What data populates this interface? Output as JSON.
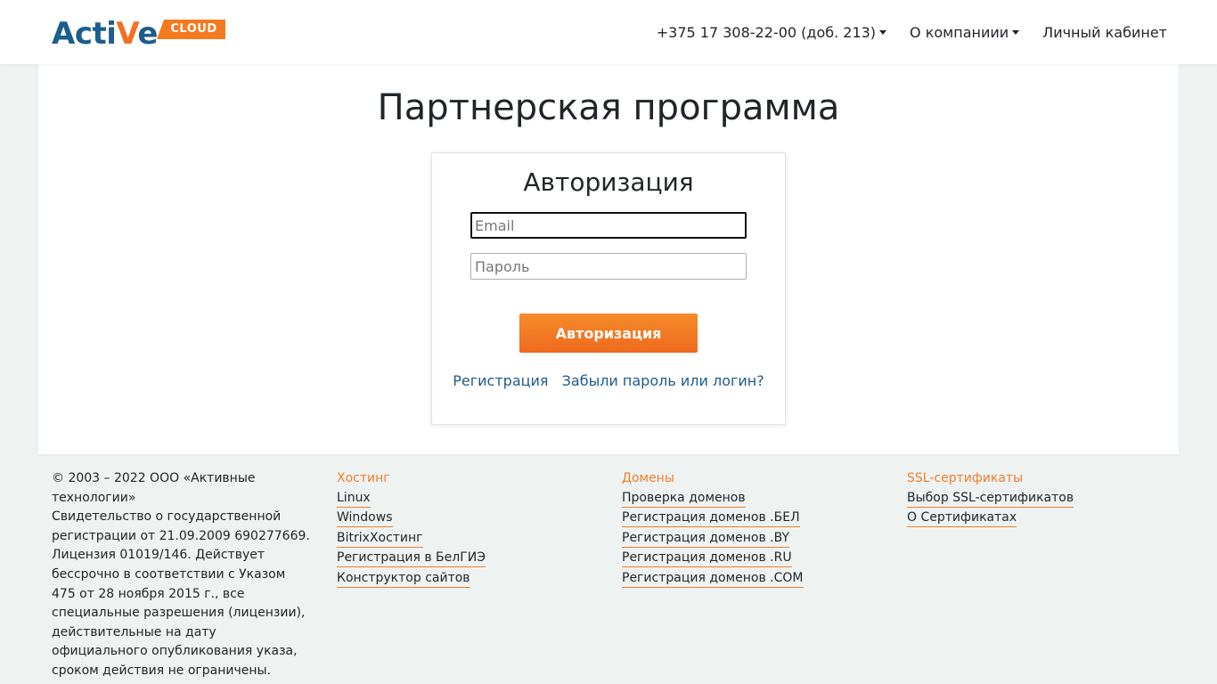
{
  "header": {
    "logo": {
      "word_part1": "Acti",
      "word_part2": "V",
      "word_part3": "e",
      "badge": "CLOUD"
    },
    "nav": {
      "phone": "+375 17 308-22-00 (доб. 213)",
      "about": "О компаниии",
      "cabinet": "Личный кабинет"
    }
  },
  "main": {
    "title": "Партнерская программа",
    "auth": {
      "title": "Авторизация",
      "email_placeholder": "Email",
      "password_placeholder": "Пароль",
      "submit_label": "Авторизация",
      "register_link": "Регистрация",
      "forgot_link": "Забыли пароль или логин?"
    }
  },
  "footer": {
    "legal": {
      "line1": "© 2003 – 2022 ООО «Активные технологии»",
      "line2": "Свидетельство о государственной регистрации от 21.09.2009 690277669. Лицензия 01019/146. Действует бессрочно в соответствии с Указом 475 от 28 ноября 2015 г., все специальные разрешения (лицензии), действительные на дату официального опубликования указа, сроком действия не ограничены."
    },
    "hosting": {
      "heading": "Хостинг",
      "links": [
        "Linux",
        "Windows",
        "BitrixХостинг",
        "Регистрация в БелГИЭ",
        "Конструктор сайтов"
      ]
    },
    "domains": {
      "heading": "Домены",
      "links": [
        "Проверка доменов",
        "Регистрация доменов .БЕЛ",
        "Регистрация доменов .BY",
        "Регистрация доменов .RU",
        "Регистрация доменов .COM"
      ]
    },
    "ssl": {
      "heading": "SSL-сертификаты",
      "links": [
        "Выбор SSL-сертификатов",
        "О Сертификатах"
      ]
    }
  },
  "colors": {
    "accent_orange": "#f07d2a",
    "brand_blue": "#1d5d8e",
    "link_blue": "#1e5a8c",
    "page_bg": "#eef3f1"
  }
}
